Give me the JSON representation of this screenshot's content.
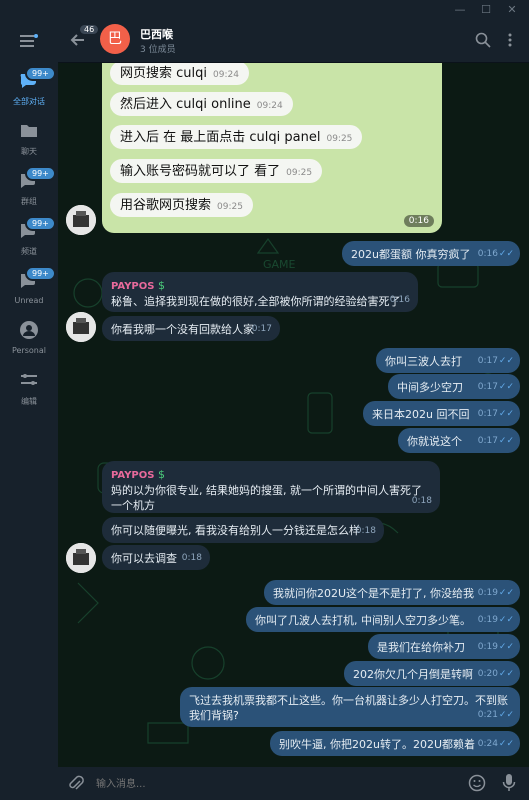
{
  "window": {
    "minimize": "—",
    "maximize": "☐",
    "close": "✕"
  },
  "sidebar": {
    "menu_icon": "menu-icon",
    "items": [
      {
        "label": "全部对话",
        "badge": "99+",
        "icon": "chats-icon"
      },
      {
        "label": "聊天",
        "badge": "",
        "icon": "folder-icon"
      },
      {
        "label": "群组",
        "badge": "99+",
        "icon": "group-icon"
      },
      {
        "label": "频道",
        "badge": "99+",
        "icon": "channel-icon"
      },
      {
        "label": "Unread",
        "badge": "99+",
        "icon": "unread-icon"
      },
      {
        "label": "Personal",
        "badge": "",
        "icon": "person-icon"
      },
      {
        "label": "编辑",
        "badge": "",
        "icon": "edit-icon"
      }
    ]
  },
  "header": {
    "back_count": "46",
    "avatar_letter": "巴",
    "title": "巴西喉",
    "subtitle": "3 位成员"
  },
  "image_msg": {
    "lines": [
      {
        "text": "网页搜索 culqi",
        "time": "09:24"
      },
      {
        "text": "然后进入 culqi online",
        "time": "09:24"
      },
      {
        "text": "进入后 在 最上面点击 culqi panel",
        "time": "09:25"
      },
      {
        "text": "输入账号密码就可以了 看了",
        "time": "09:25"
      },
      {
        "text": "用谷歌网页搜索",
        "time": "09:25"
      }
    ],
    "duration": "0:16"
  },
  "messages": [
    {
      "text": "202u都蛋额 你真穷疯了",
      "time": "0:16"
    },
    {
      "sender": "PAYPOS",
      "text": "秘鲁、追择我到现在做的很好,全部被你所谓的经验给害死了",
      "time": "0:16"
    },
    {
      "text": "你看我哪一个没有回款给人家",
      "time": "0:17"
    },
    {
      "text": "你叫三波人去打",
      "time": "0:17"
    },
    {
      "text": "中间多少空刀",
      "time": "0:17"
    },
    {
      "text": "来日本202u 回不回",
      "time": "0:17"
    },
    {
      "text": "你就说这个",
      "time": "0:17"
    },
    {
      "sender": "PAYPOS",
      "text": "妈的以为你很专业, 结果她妈的搜蛋, 就一个所谓的中间人害死了一个机方",
      "time": "0:18"
    },
    {
      "text": "你可以随便曝光, 看我没有给别人一分钱还是怎么样",
      "time": "0:18"
    },
    {
      "text": "你可以去调查",
      "time": "0:18"
    },
    {
      "text": "我就问你202U这个是不是打了, 你没给我",
      "time": "0:19"
    },
    {
      "text": "你叫了几波人去打机, 中间别人空刀多少笔。",
      "time": "0:19"
    },
    {
      "text": "是我们在给你补刀",
      "time": "0:19"
    },
    {
      "text": "202你欠几个月倒是转啊",
      "time": "0:20"
    },
    {
      "text": "飞过去我机票我都不止这些。你一台机器让多少人打空刀。不到账我们背锅?",
      "time": "0:21"
    },
    {
      "text": "别吹牛逼, 你把202u转了。202U都赖着",
      "time": "0:24"
    }
  ],
  "input": {
    "placeholder": "输入消息..."
  }
}
